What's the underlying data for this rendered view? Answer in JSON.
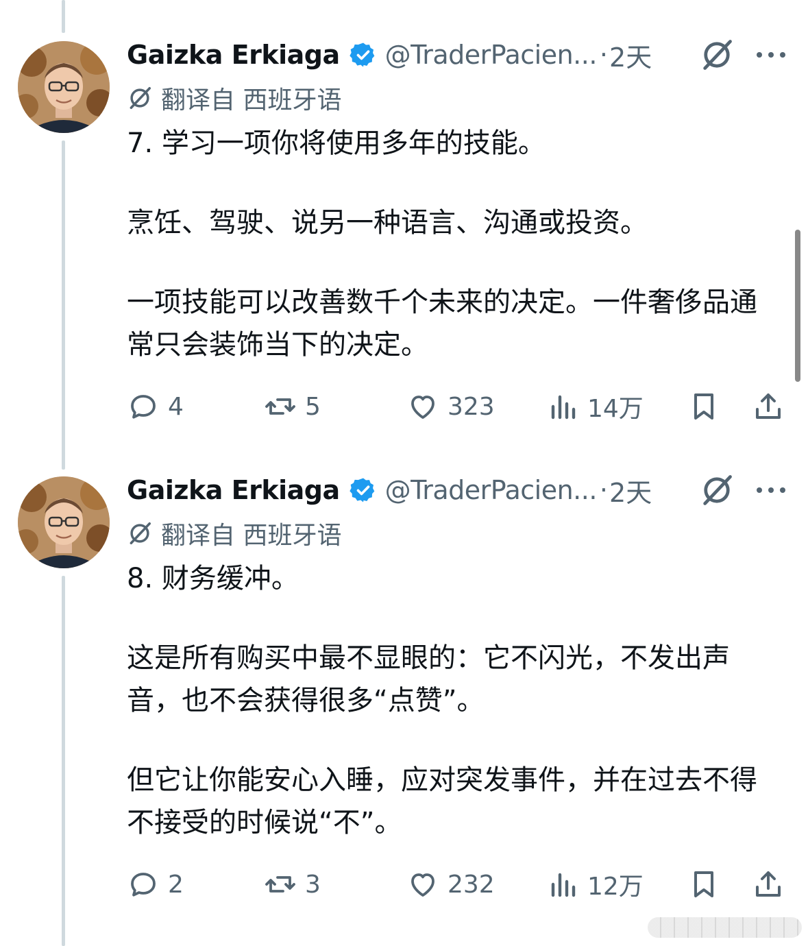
{
  "tweets": [
    {
      "author": "Gaizka Erkiaga",
      "handle": "@TraderPacien...",
      "separator": "·",
      "time": "2天",
      "translated_label": "翻译自 西班牙语",
      "paragraphs": [
        "7. 学习一项你将使用多年的技能。",
        "烹饪、驾驶、说另一种语言、沟通或投资。",
        "一项技能可以改善数千个未来的决定。一件奢侈品通常只会装饰当下的决定。"
      ],
      "stats": {
        "replies": "4",
        "retweets": "5",
        "likes": "323",
        "views": "14万"
      }
    },
    {
      "author": "Gaizka Erkiaga",
      "handle": "@TraderPacien...",
      "separator": "·",
      "time": "2天",
      "translated_label": "翻译自 西班牙语",
      "paragraphs": [
        "8. 财务缓冲。",
        "这是所有购买中最不显眼的：它不闪光，不发出声音，也不会获得很多“点赞”。",
        "但它让你能安心入睡，应对突发事件，并在过去不得不接受的时候说“不”。"
      ],
      "stats": {
        "replies": "2",
        "retweets": "3",
        "likes": "232",
        "views": "12万"
      }
    }
  ],
  "icons": {
    "verified": "verified-badge-icon",
    "grok": "grok-icon",
    "more": "more-icon",
    "reply": "reply-icon",
    "retweet": "retweet-icon",
    "like": "heart-icon",
    "views": "views-icon",
    "bookmark": "bookmark-icon",
    "share": "share-icon"
  },
  "colors": {
    "verified_blue": "#1d9bf0",
    "muted_text": "#536471",
    "thread_line": "#cfd9de"
  }
}
